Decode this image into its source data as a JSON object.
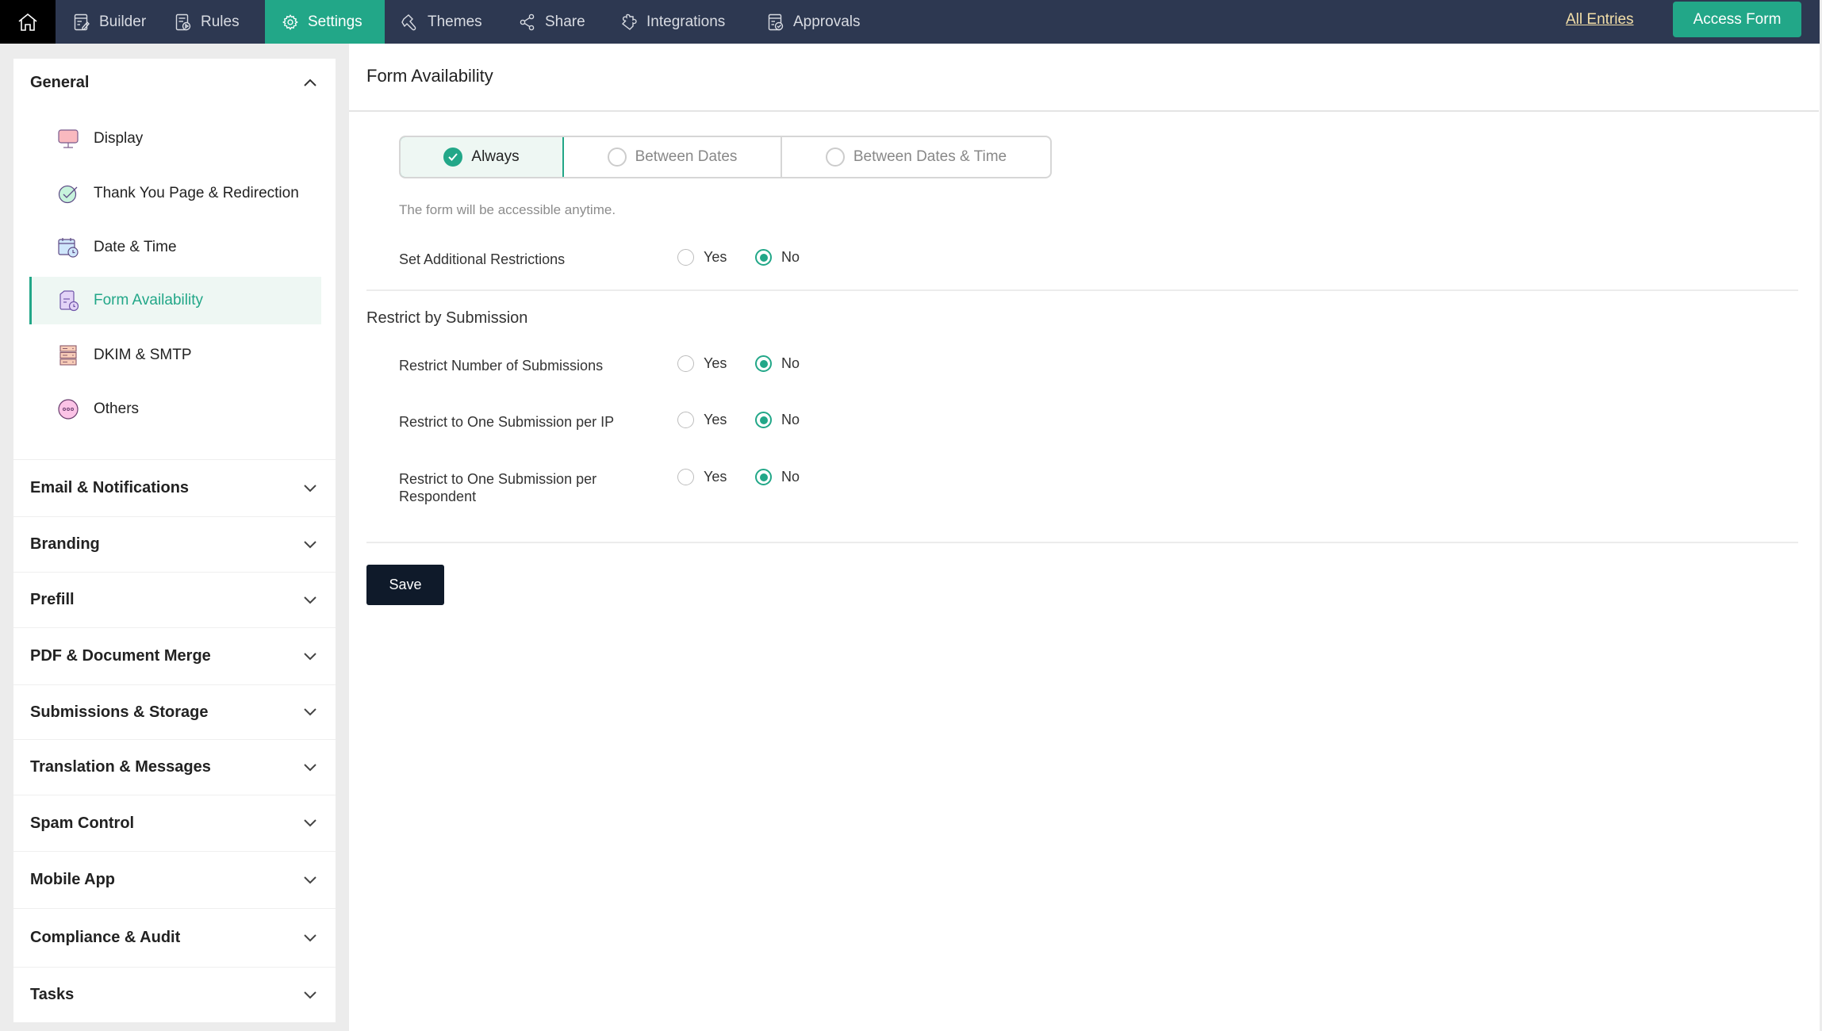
{
  "topbar": {
    "home_icon": "home-icon",
    "tabs": [
      {
        "label": "Builder",
        "icon": "builder-icon",
        "active": false
      },
      {
        "label": "Rules",
        "icon": "rules-icon",
        "active": false
      },
      {
        "label": "Settings",
        "icon": "gear-icon",
        "active": true
      },
      {
        "label": "Themes",
        "icon": "brush-icon",
        "active": false
      },
      {
        "label": "Share",
        "icon": "share-icon",
        "active": false
      },
      {
        "label": "Integrations",
        "icon": "puzzle-icon",
        "active": false
      },
      {
        "label": "Approvals",
        "icon": "approvals-icon",
        "active": false
      }
    ],
    "all_entries": "All Entries",
    "access_form": "Access Form"
  },
  "sidebar": {
    "general": {
      "label": "General",
      "expanded": true,
      "items": [
        {
          "label": "Display",
          "icon": "monitor-icon",
          "active": false
        },
        {
          "label": "Thank You Page & Redirection",
          "icon": "check-circle-icon",
          "active": false
        },
        {
          "label": "Date & Time",
          "icon": "calendar-clock-icon",
          "active": false
        },
        {
          "label": "Form Availability",
          "icon": "form-clock-icon",
          "active": true
        },
        {
          "label": "DKIM & SMTP",
          "icon": "server-icon",
          "active": false
        },
        {
          "label": "Others",
          "icon": "more-icon",
          "active": false
        }
      ]
    },
    "sections": [
      {
        "label": "Email & Notifications"
      },
      {
        "label": "Branding"
      },
      {
        "label": "Prefill"
      },
      {
        "label": "PDF & Document Merge"
      },
      {
        "label": "Submissions & Storage"
      },
      {
        "label": "Translation & Messages"
      },
      {
        "label": "Spam Control"
      },
      {
        "label": "Mobile App"
      },
      {
        "label": "Compliance & Audit"
      },
      {
        "label": "Tasks"
      }
    ]
  },
  "main": {
    "title": "Form Availability",
    "availability_options": [
      {
        "label": "Always",
        "selected": true
      },
      {
        "label": "Between Dates",
        "selected": false
      },
      {
        "label": "Between Dates & Time",
        "selected": false
      }
    ],
    "helper_text": "The form will be accessible anytime.",
    "additional_restrictions": {
      "label": "Set Additional Restrictions",
      "yes": "Yes",
      "no": "No",
      "value": "No"
    },
    "restrict_section_title": "Restrict by Submission",
    "restrictions": [
      {
        "label": "Restrict Number of Submissions",
        "yes": "Yes",
        "no": "No",
        "value": "No"
      },
      {
        "label": "Restrict to One Submission per IP",
        "yes": "Yes",
        "no": "No",
        "value": "No"
      },
      {
        "label": "Restrict to One Submission per Respondent",
        "yes": "Yes",
        "no": "No",
        "value": "No"
      }
    ],
    "save_label": "Save"
  },
  "colors": {
    "accent": "#22a788",
    "navbar": "#2d3851",
    "save_button": "#0f1a2a",
    "all_entries_link": "#f3dfa8"
  }
}
